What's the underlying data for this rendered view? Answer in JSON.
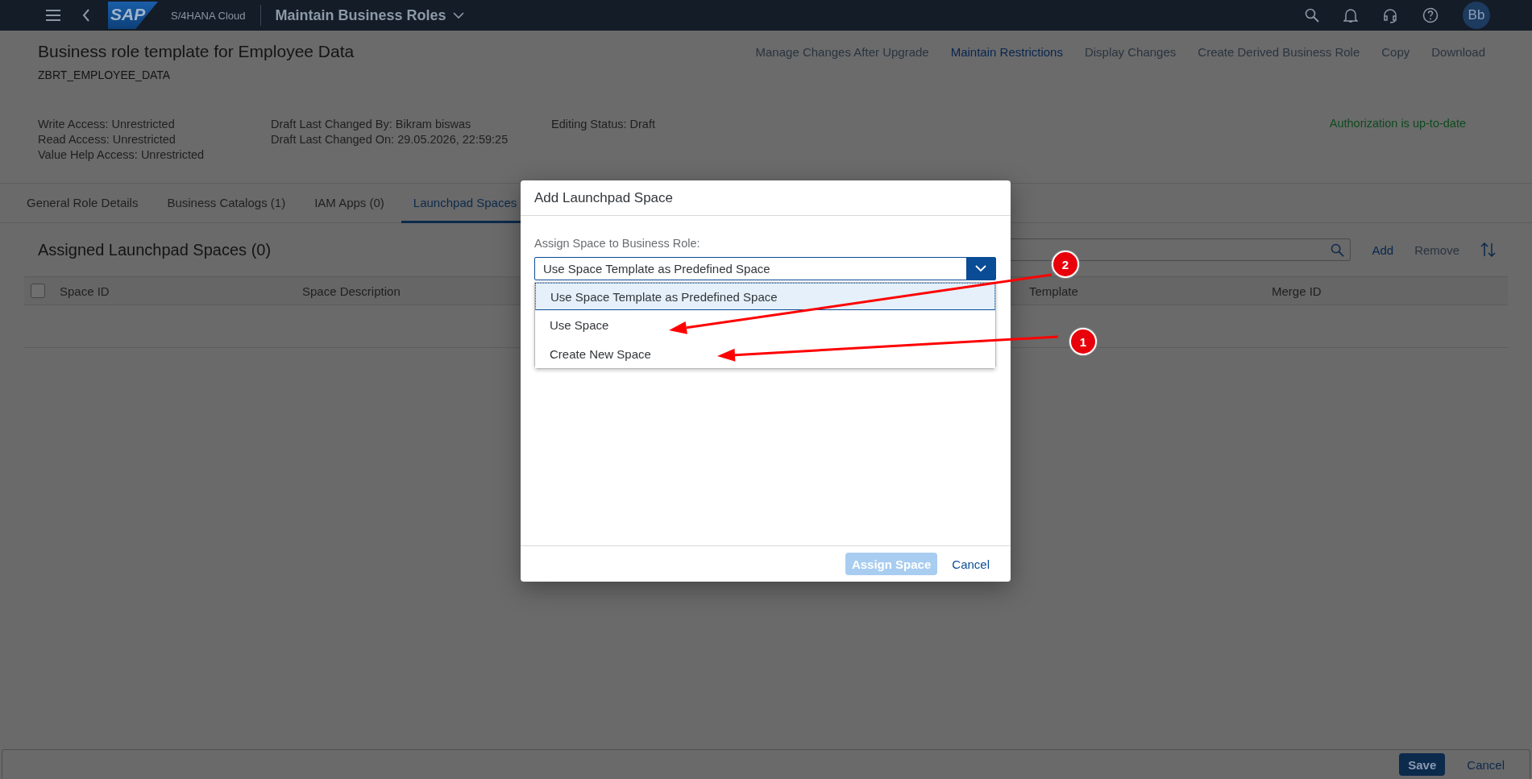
{
  "shell": {
    "logo": "SAP",
    "product": "S/4HANA Cloud",
    "app_title": "Maintain Business Roles",
    "avatar": "Bb"
  },
  "header": {
    "title": "Business role template for Employee Data",
    "id": "ZBRT_EMPLOYEE_DATA",
    "actions": [
      {
        "label": "Manage Changes After Upgrade",
        "disabled": true
      },
      {
        "label": "Maintain Restrictions",
        "disabled": false
      },
      {
        "label": "Display Changes",
        "disabled": true
      },
      {
        "label": "Create Derived Business Role",
        "disabled": true
      },
      {
        "label": "Copy",
        "disabled": true
      },
      {
        "label": "Download",
        "disabled": true
      }
    ],
    "info_columns": [
      [
        "Write Access: Unrestricted",
        "Read Access: Unrestricted",
        "Value Help Access: Unrestricted"
      ],
      [
        "Draft Last Changed By: Bikram biswas",
        "Draft Last Changed On: 29.05.2026, 22:59:25"
      ],
      [
        "Editing Status: Draft"
      ]
    ],
    "status": "Authorization is up-to-date"
  },
  "tabs": [
    {
      "label": "General Role Details",
      "selected": false
    },
    {
      "label": "Business Catalogs (1)",
      "selected": false
    },
    {
      "label": "IAM Apps (0)",
      "selected": false
    },
    {
      "label": "Launchpad Spaces",
      "selected": true
    }
  ],
  "section": {
    "title": "Assigned Launchpad Spaces (0)",
    "toolbar": [
      {
        "label": "Add",
        "disabled": false
      },
      {
        "label": "Remove",
        "disabled": true
      }
    ]
  },
  "table": {
    "select_all": {
      "checked": false
    },
    "columns": [
      "Space ID",
      "Space Description",
      "",
      "Template",
      "Merge ID"
    ]
  },
  "dialog": {
    "title": "Add Launchpad Space",
    "label": "Assign Space to Business Role:",
    "value": "Use Space Template as Predefined Space",
    "options": [
      {
        "label": "Use Space Template as Predefined Space",
        "selected": true
      },
      {
        "label": "Use Space",
        "selected": false
      },
      {
        "label": "Create New Space",
        "selected": false
      }
    ],
    "buttons": [
      {
        "label": "Assign Space",
        "kind": "primary",
        "disabled": true
      },
      {
        "label": "Cancel",
        "kind": "transparent",
        "disabled": false
      }
    ]
  },
  "annotations": [
    {
      "label": "2"
    },
    {
      "label": "1"
    }
  ],
  "footer": {
    "buttons": [
      {
        "label": "Save",
        "kind": "primary"
      },
      {
        "label": "Cancel",
        "kind": "transparent"
      }
    ]
  }
}
